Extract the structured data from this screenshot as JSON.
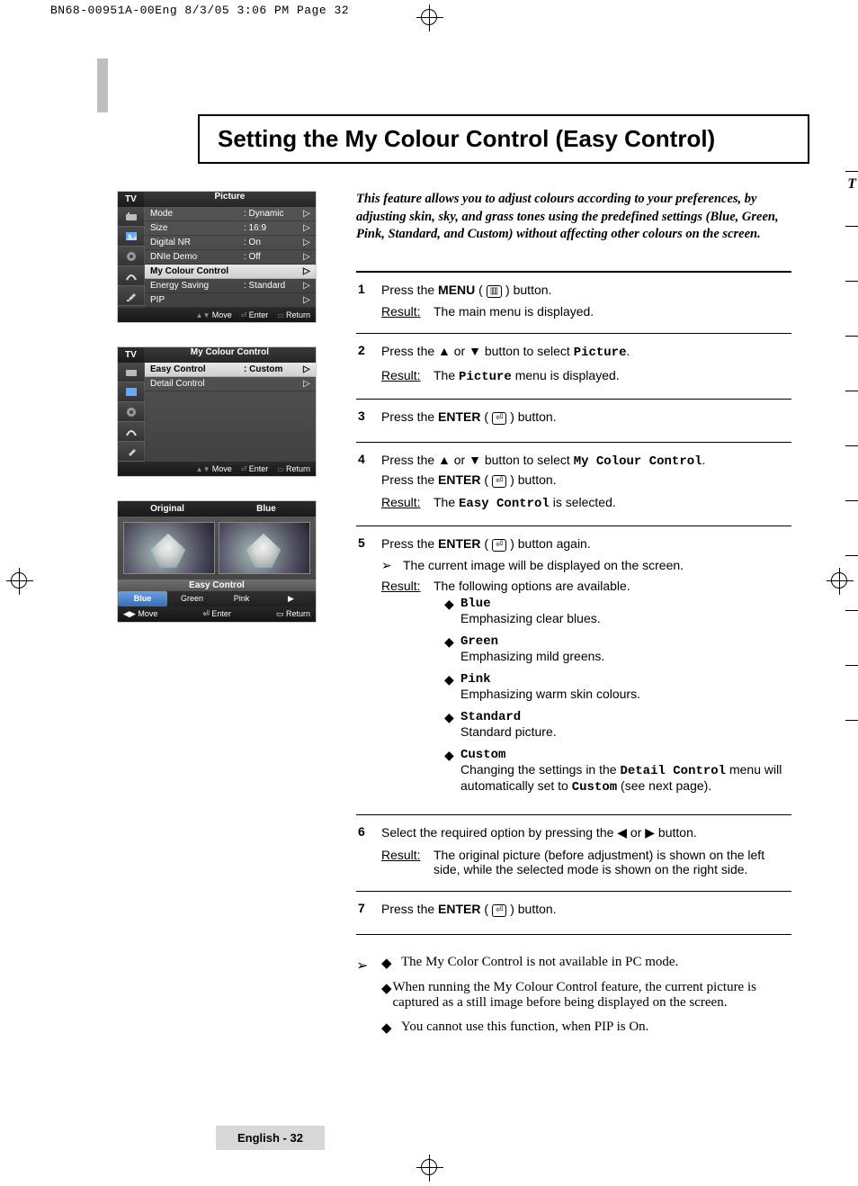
{
  "slugline": "BN68-00951A-00Eng  8/3/05  3:06 PM  Page 32",
  "title": "Setting the My Colour Control (Easy Control)",
  "intro": "This feature allows you to adjust colours according to your preferences, by adjusting skin, sky, and grass tones using the predefined settings (Blue, Green, Pink, Standard, and Custom) without affecting other colours on the screen.",
  "osd1": {
    "tab": "TV",
    "title": "Picture",
    "rows": [
      {
        "label": "Mode",
        "value": ": Dynamic",
        "sel": false
      },
      {
        "label": "Size",
        "value": ": 16:9",
        "sel": false
      },
      {
        "label": "Digital NR",
        "value": ": On",
        "sel": false
      },
      {
        "label": "DNIe Demo",
        "value": ": Off",
        "sel": false
      },
      {
        "label": "My Colour Control",
        "value": "",
        "sel": true
      },
      {
        "label": "Energy Saving",
        "value": ": Standard",
        "sel": false
      },
      {
        "label": "PIP",
        "value": "",
        "sel": false
      }
    ],
    "foot_move": "Move",
    "foot_enter": "Enter",
    "foot_return": "Return"
  },
  "osd2": {
    "tab": "TV",
    "title": "My Colour Control",
    "rows": [
      {
        "label": "Easy Control",
        "value": ": Custom",
        "sel": true
      },
      {
        "label": "Detail Control",
        "value": "",
        "sel": false
      }
    ],
    "foot_move": "Move",
    "foot_enter": "Enter",
    "foot_return": "Return"
  },
  "ec": {
    "left_label": "Original",
    "right_label": "Blue",
    "band": "Easy Control",
    "opts": [
      "Blue",
      "Green",
      "Pink"
    ],
    "sel_index": 0,
    "foot_move": "Move",
    "foot_enter": "Enter",
    "foot_return": "Return"
  },
  "steps": {
    "s1": {
      "num": "1",
      "line1a": "Press the ",
      "line1b": "MENU",
      "line1c": " ( ",
      "line1d": " ) button.",
      "result": "The main menu is displayed."
    },
    "s2": {
      "num": "2",
      "line1": "Press the ▲ or ▼ button to select ",
      "kw": "Picture",
      "line1end": ".",
      "result_a": "The ",
      "result_kw": "Picture",
      "result_b": " menu is displayed."
    },
    "s3": {
      "num": "3",
      "line": "Press the ",
      "kw": "ENTER",
      "tail": " ( ",
      "tail2": " ) button."
    },
    "s4": {
      "num": "4",
      "l1": "Press the ▲ or ▼ button to select ",
      "kw1": "My Colour Control",
      "l1end": ".",
      "l2a": "Press the ",
      "kw2": "ENTER",
      "l2b": " ( ",
      "l2c": " ) button.",
      "result_a": "The ",
      "result_kw": "Easy Control",
      "result_b": " is selected."
    },
    "s5": {
      "num": "5",
      "l1a": "Press the ",
      "kw": "ENTER",
      "l1b": " ( ",
      "l1c": " ) button again.",
      "note": "The current image will be displayed on the screen.",
      "result": "The following options are available.",
      "opts": [
        {
          "name": "Blue",
          "desc": "Emphasizing clear blues."
        },
        {
          "name": "Green",
          "desc": "Emphasizing mild greens."
        },
        {
          "name": "Pink",
          "desc": "Emphasizing warm skin colours."
        },
        {
          "name": "Standard",
          "desc": "Standard picture."
        },
        {
          "name": "Custom",
          "desc": "Changing the settings in the Detail Control menu will automatically set to Custom (see next page).",
          "desc_kw1": "Detail Control",
          "desc_kw2": "Custom"
        }
      ]
    },
    "s6": {
      "num": "6",
      "line": "Select the required option by pressing the ◀ or ▶ button.",
      "result": "The original picture (before adjustment) is shown on the left side, while the selected mode is shown on the right side."
    },
    "s7": {
      "num": "7",
      "la": "Press the ",
      "kw": "ENTER",
      "lb": " ( ",
      "lc": " ) button."
    }
  },
  "notes": [
    "The My Color Control is not available in PC mode.",
    "When running the My Colour Control feature, the current picture is captured as a still image before being displayed on the screen.",
    "You cannot use this function, when PIP is On."
  ],
  "footer": "English - 32",
  "edge_letter": "T"
}
